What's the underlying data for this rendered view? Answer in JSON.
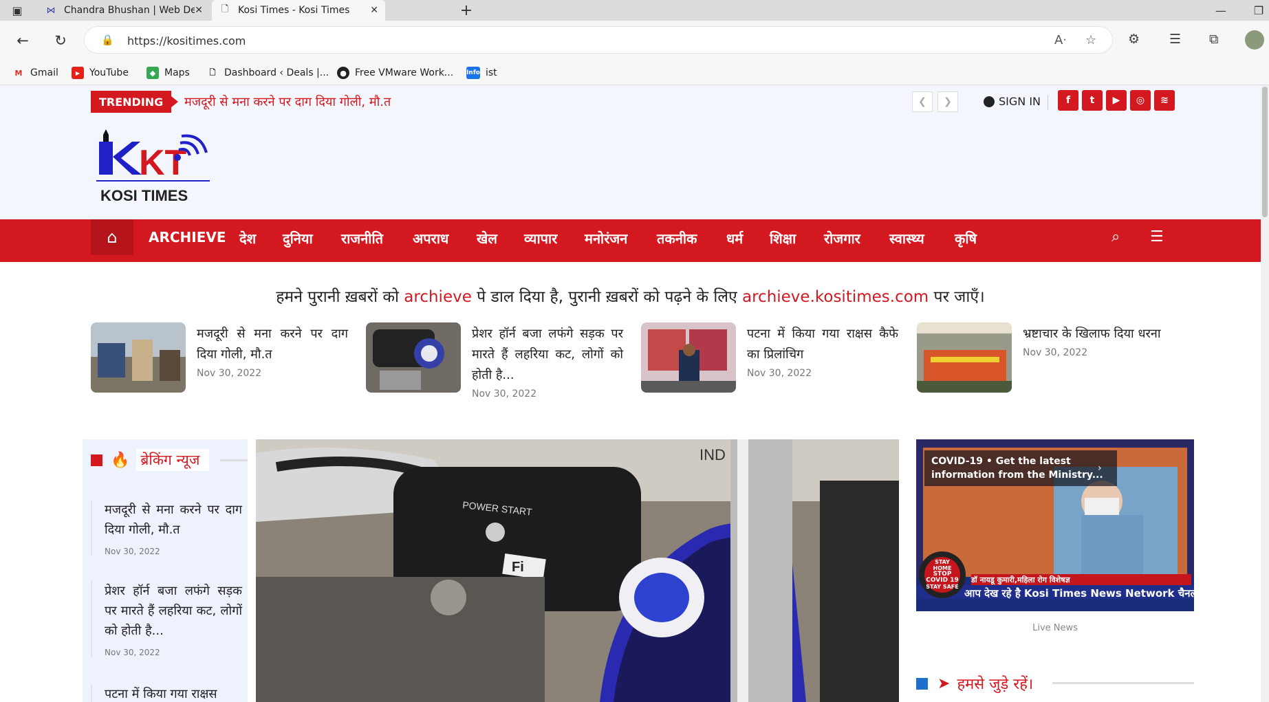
{
  "browser": {
    "tabs": [
      {
        "title": "Chandra Bhushan | Web Develop",
        "active": false
      },
      {
        "title": "Kosi Times - Kosi Times",
        "active": true
      }
    ],
    "url": "https://kositimes.com",
    "bookmarks": [
      "Gmail",
      "YouTube",
      "Maps",
      "Dashboard ‹ Deals |...",
      "Free VMware Work...",
      "ist"
    ],
    "bookmark_info_icon": "Info"
  },
  "topbar": {
    "trending_label": "TRENDING",
    "trending_text": "मजदूरी से मना करने पर दाग दिया गोली, मौ.त",
    "signin": "SIGN IN"
  },
  "logo": {
    "text": "KOSI TIMES",
    "mark": "KT"
  },
  "menu": {
    "items": [
      "ARCHIEVE",
      "देश",
      "दुनिया",
      "राजनीति",
      "अपराध",
      "खेल",
      "व्यापार",
      "मनोरंजन",
      "तकनीक",
      "धर्म",
      "शिक्षा",
      "रोजगार",
      "स्वास्थ्य",
      "कृषि"
    ]
  },
  "notice": {
    "part1": "हमने पुरानी ख़बरों को ",
    "link1": "archieve",
    "part2": " पे डाल दिया है, पुरानी ख़बरों को पढ़ने के लिए ",
    "link2": "archieve.kositimes.com",
    "part3": " पर जाएँ।"
  },
  "news_cards": [
    {
      "title": "मजदूरी से मना करने पर दाग दिया गोली, मौ.त",
      "date": "Nov 30, 2022"
    },
    {
      "title": "प्रेशर हॉर्न बजा लफंगे सड़क पर मारते हैं लहरिया कट, लोगों को होती है...",
      "date": "Nov 30, 2022"
    },
    {
      "title": "पटना में किया गया राक्षस कैफे का प्रिलांचिग",
      "date": "Nov 30, 2022"
    },
    {
      "title": "भ्रष्टाचार के खिलाफ दिया धरना",
      "date": "Nov 30, 2022"
    }
  ],
  "breaking": {
    "title": "ब्रेकिंग न्यूज",
    "items": [
      {
        "title": "मजदूरी से मना करने पर दाग दिया गोली, मौ.त",
        "date": "Nov 30, 2022"
      },
      {
        "title": "प्रेशर हॉर्न बजा लफंगे सड़क पर मारते हैं लहरिया कट, लोगों को होती है...",
        "date": "Nov 30, 2022"
      },
      {
        "title": "पटना में किया गया राक्षस",
        "date": ""
      }
    ]
  },
  "hero": {
    "tank_text": "POWER START",
    "badge": "Fi",
    "plate": "IND BR"
  },
  "video": {
    "banner": "COVID-19 • Get the latest information from the Ministry...",
    "caption_small": "डॉ नायडू कुमारी,महिला रोग विशेषज्ञ",
    "caption_big": "आप देख रहे है Kosi Times News Network चैनल",
    "stamp": "STOP COVID 19",
    "stamp_top": "STAY HOME",
    "stamp_bottom": "STAY SAFE"
  },
  "live_label": "Live News",
  "connect_title": "हमसे जुड़े रहें।",
  "colors": {
    "brand_red": "#d4181f",
    "header_bg": "#f3f6fd"
  }
}
